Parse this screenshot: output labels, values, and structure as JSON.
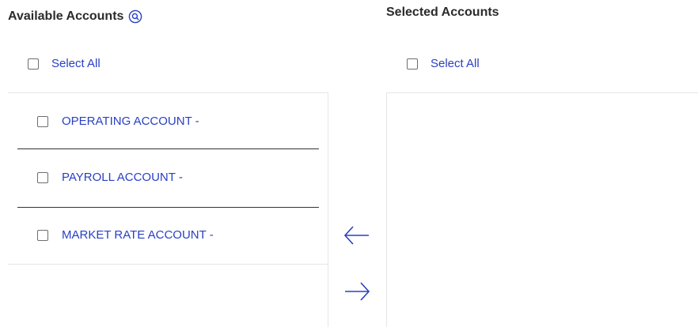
{
  "available": {
    "title": "Available Accounts",
    "search_icon": "search-icon",
    "select_all_label": "Select All",
    "accounts": [
      {
        "label": "OPERATING ACCOUNT -",
        "checked": false
      },
      {
        "label": "PAYROLL ACCOUNT -",
        "checked": false
      },
      {
        "label": "MARKET RATE ACCOUNT -",
        "checked": false
      }
    ]
  },
  "selected": {
    "title": "Selected Accounts",
    "select_all_label": "Select All",
    "accounts": []
  },
  "controls": {
    "move_left_icon": "arrow-left-icon",
    "move_right_icon": "arrow-right-icon"
  },
  "colors": {
    "link": "#2940c4",
    "heading": "#2b2b2b",
    "divider": "#333333",
    "border": "#e6e6e6"
  }
}
